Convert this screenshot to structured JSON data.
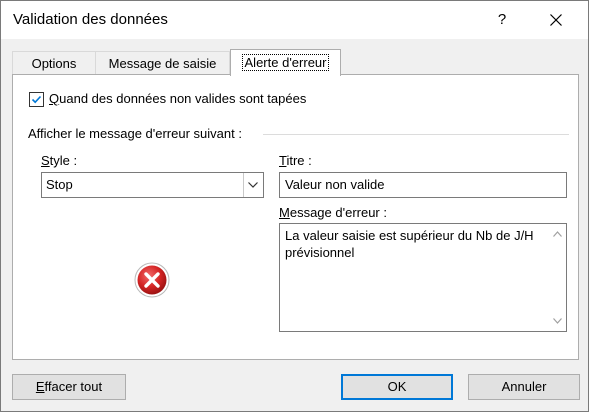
{
  "window": {
    "title": "Validation des données",
    "help_glyph": "?",
    "close_icon": "close-icon"
  },
  "tabs": [
    {
      "label": "Options",
      "active": false
    },
    {
      "label": "Message de saisie",
      "active": false
    },
    {
      "label": "Alerte d'erreur",
      "active": true
    }
  ],
  "alert": {
    "checkbox": {
      "checked": true,
      "label_first": "Q",
      "label_rest": "uand des données non valides sont tapées"
    },
    "group_label": "Afficher le message d'erreur suivant :",
    "style": {
      "label_first": "S",
      "label_rest": "tyle :",
      "value": "Stop",
      "icon": "stop-error-icon"
    },
    "title_field": {
      "label_first": "T",
      "label_rest": "itre :",
      "value": "Valeur non valide"
    },
    "message_field": {
      "label_first": "M",
      "label_rest": "essage d'erreur :",
      "value": "La valeur saisie est supérieur du Nb de J/H prévisionnel"
    }
  },
  "buttons": {
    "clear_first": "E",
    "clear_rest": "ffacer tout",
    "ok": "OK",
    "cancel": "Annuler"
  },
  "colors": {
    "accent": "#0078d7",
    "checkbox_tick": "#0078d7",
    "stop_icon": "#c81e1e"
  }
}
